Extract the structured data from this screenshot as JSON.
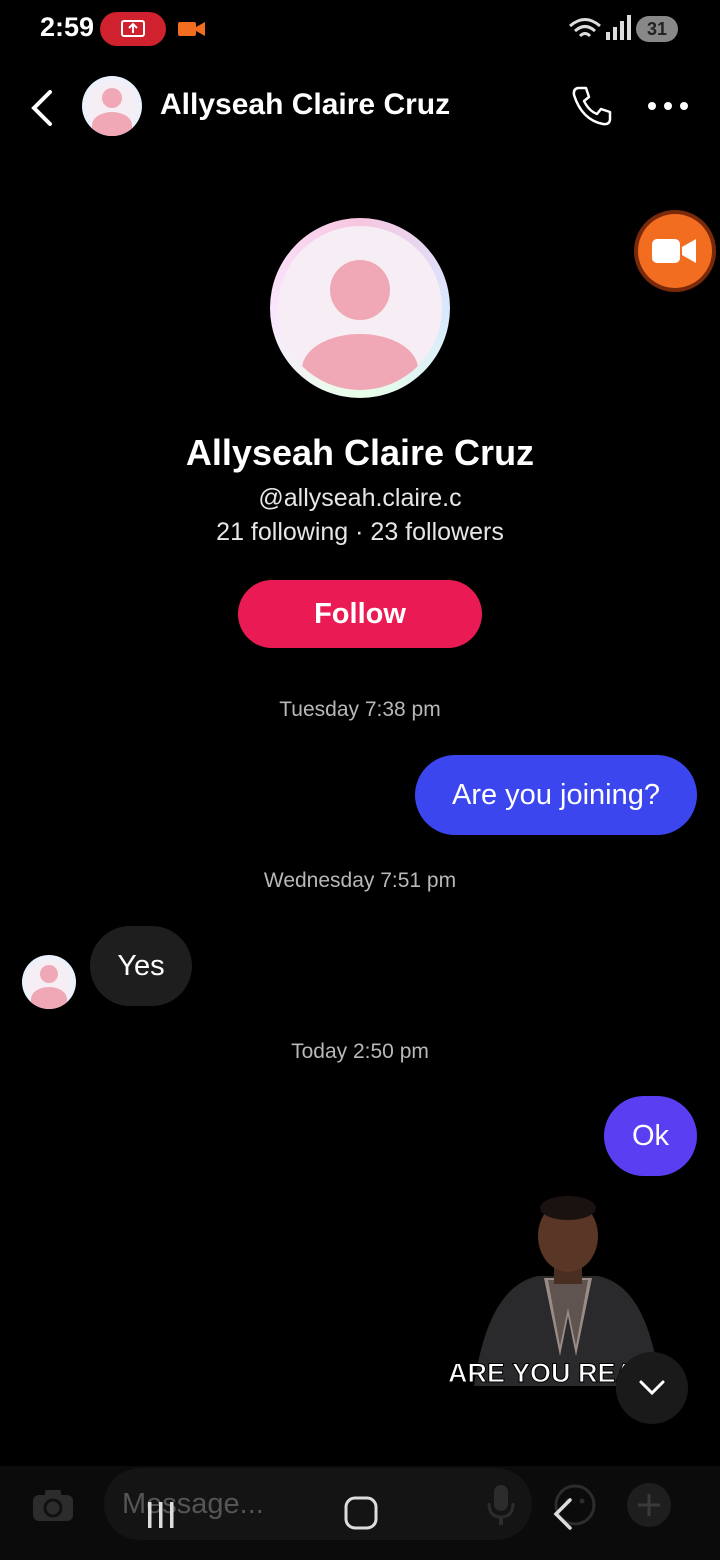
{
  "status_bar": {
    "time": "2:59",
    "battery": "31"
  },
  "header": {
    "title": "Allyseah Claire Cruz"
  },
  "profile": {
    "name": "Allyseah Claire Cruz",
    "handle": "@allyseah.claire.c",
    "stats": "21 following · 23 followers",
    "follow_label": "Follow"
  },
  "messages": [
    {
      "timestamp": "Tuesday 7:38 pm",
      "text": "Are you joining?",
      "direction": "outgoing"
    },
    {
      "timestamp": "Wednesday 7:51 pm",
      "text": "Yes",
      "direction": "incoming"
    },
    {
      "timestamp": "Today 2:50 pm",
      "text": "Ok",
      "direction": "outgoing"
    }
  ],
  "gif": {
    "caption": "ARE YOU REA"
  },
  "composer": {
    "placeholder": "Message..."
  },
  "colors": {
    "follow": "#ea1b54",
    "bubble_out": "#3c46ee",
    "bubble_out2": "#5a3ff2",
    "video_fab": "#f26d1f"
  }
}
